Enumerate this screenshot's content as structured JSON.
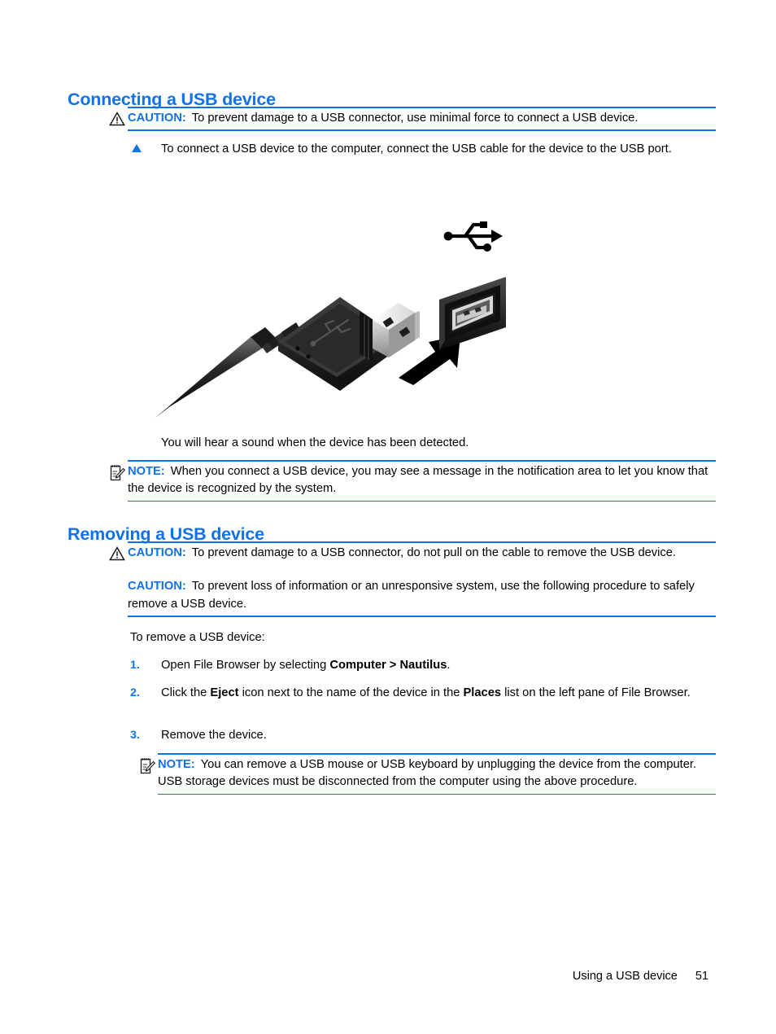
{
  "document": {
    "type": "user-guide-page"
  },
  "sections": {
    "connecting": {
      "heading": "Connecting a USB device",
      "caution": {
        "label": "CAUTION:",
        "icon": "warning-triangle-icon",
        "text": "To prevent damage to a USB connector, use minimal force to connect a USB device."
      },
      "step_bullet": {
        "marker": "triangle-bullet-icon",
        "text": "To connect a USB device to the computer, connect the USB cable for the device to the USB port."
      },
      "illustration": {
        "name": "usb-cable-to-port-illustration",
        "alt": "USB Type-A plug being inserted into a USB port marked with the USB trident symbol"
      },
      "after_image_text": "You will hear a sound when the device has been detected.",
      "note": {
        "label": "NOTE:",
        "icon": "note-pad-pencil-icon",
        "text": "When you connect a USB device, you may see a message in the notification area to let you know that the device is recognized by the system."
      }
    },
    "removing": {
      "heading": "Removing a USB device",
      "caution": {
        "label": "CAUTION:",
        "icon": "warning-triangle-icon",
        "text": "To prevent damage to a USB connector, do not pull on the cable to remove the USB device.",
        "second_label": "CAUTION:",
        "second_text": "To prevent loss of information or an unresponsive system, use the following procedure to safely remove a USB device."
      },
      "intro": "To remove a USB device:",
      "steps": [
        {
          "number": "1.",
          "text_before": "Open File Browser by selecting ",
          "bold": "Computer > Nautilus",
          "text_after": "."
        },
        {
          "number": "2.",
          "text_before": "Click the ",
          "bold": "Eject",
          "text_mid": " icon next to the name of the device in the ",
          "bold2": "Places",
          "text_after": " list on the left pane of File Browser."
        },
        {
          "number": "3.",
          "text_before": "Remove the device.",
          "bold": "",
          "text_after": ""
        }
      ],
      "note": {
        "label": "NOTE:",
        "icon": "note-pad-pencil-icon",
        "text": "You can remove a USB mouse or USB keyboard by unplugging the device from the computer. USB storage devices must be disconnected from the computer using the above procedure."
      }
    }
  },
  "footer": {
    "chapter": "Using a USB device",
    "page_number": "51"
  },
  "colors": {
    "heading_blue": "#1172e8",
    "rule_blue": "#1172e8",
    "body_black": "#000000",
    "page_background": "#ffffff"
  }
}
